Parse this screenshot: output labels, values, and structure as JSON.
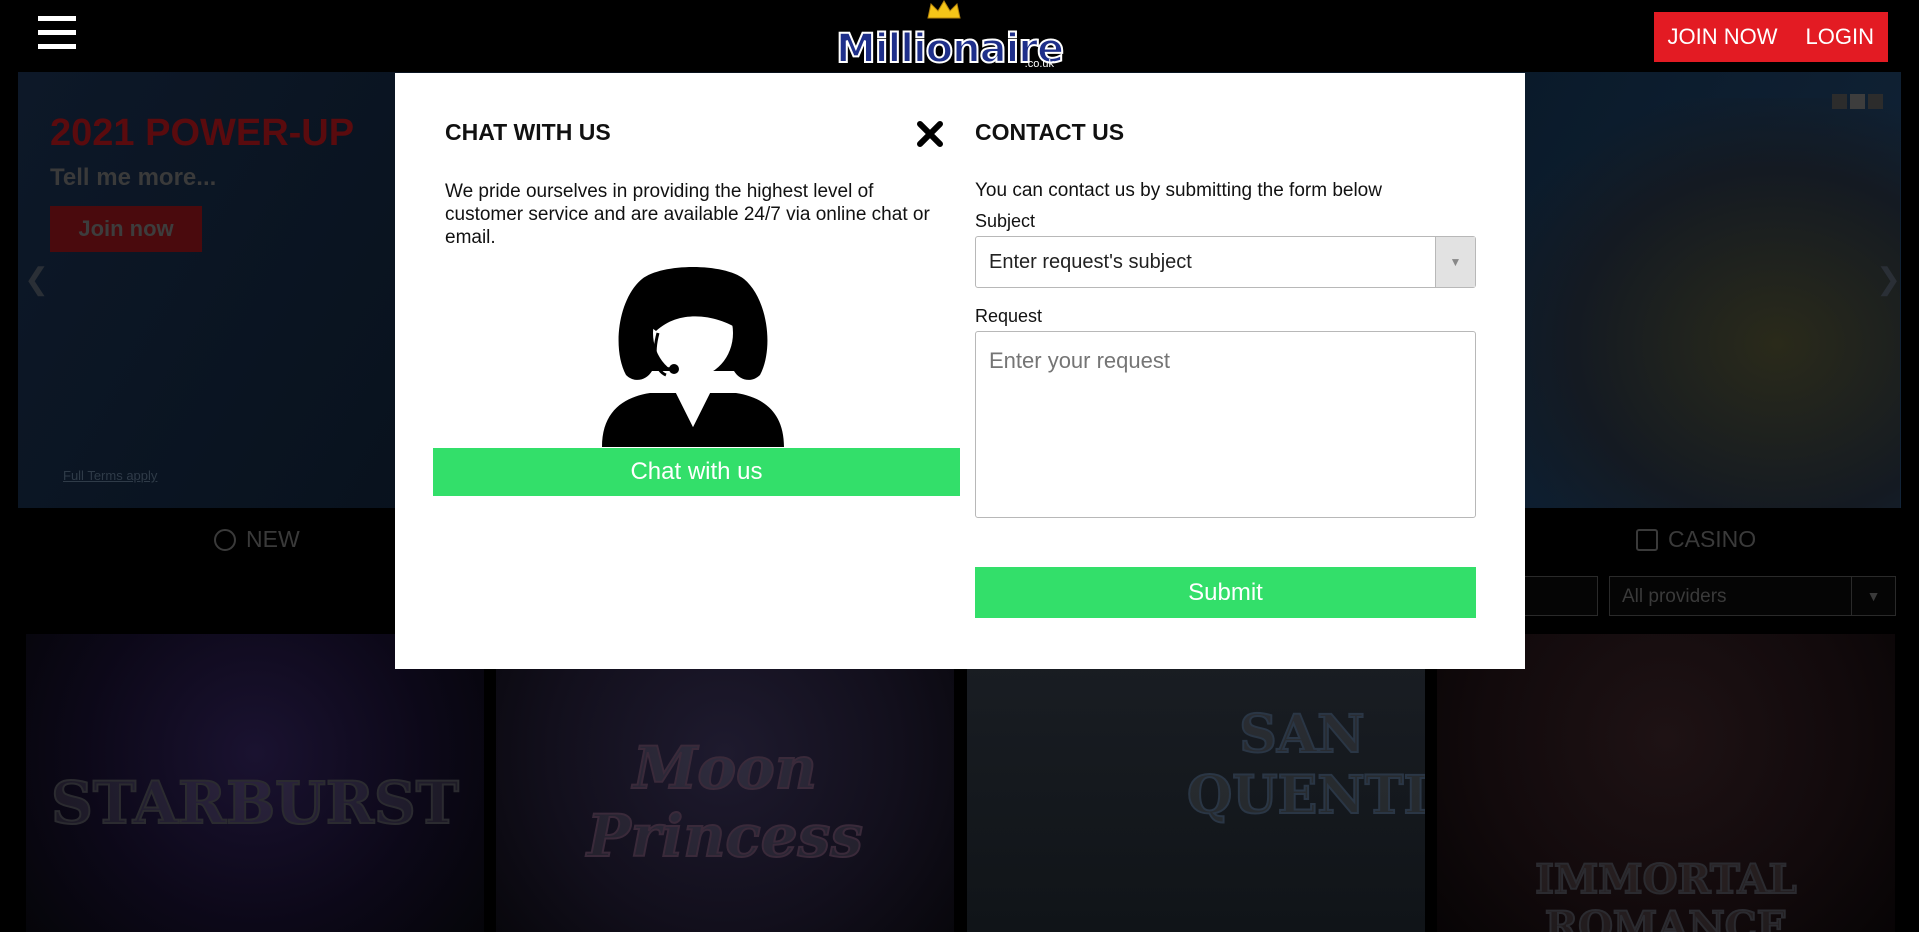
{
  "header": {
    "logo_text": "Millionaire",
    "logo_sub": ".co.uk",
    "join_label": "JOIN NOW",
    "login_label": "LOGIN"
  },
  "hero": {
    "title": "2021 POWER-UP",
    "subtitle": "Tell me more...",
    "join_label": "Join now",
    "terms": "Full Terms apply"
  },
  "tabs": {
    "new_label": "NEW",
    "casino_label": "CASINO"
  },
  "filters": {
    "providers_value": "All providers"
  },
  "games": [
    {
      "title": "STARBURST"
    },
    {
      "title": "Moon Princess"
    },
    {
      "title": "SAN QUENTIN"
    },
    {
      "title": "IMMORTAL ROMANCE"
    }
  ],
  "modal": {
    "chat": {
      "heading": "CHAT WITH US",
      "text": "We pride ourselves in providing the highest level of customer service and are available 24/7 via online chat or email.",
      "button": "Chat with us"
    },
    "contact": {
      "heading": "CONTACT US",
      "text": "You can contact us by submitting the form below",
      "subject_label": "Subject",
      "subject_value": "Enter request's subject",
      "request_label": "Request",
      "request_placeholder": "Enter your request",
      "submit": "Submit"
    }
  },
  "colors": {
    "brand_red": "#e31b23",
    "action_green": "#33df6a",
    "logo_blue": "#1e2f8a"
  },
  "icons": [
    "menu-icon",
    "close-icon",
    "chevron-down-icon",
    "support-agent-icon",
    "stopwatch-icon",
    "cards-icon"
  ]
}
